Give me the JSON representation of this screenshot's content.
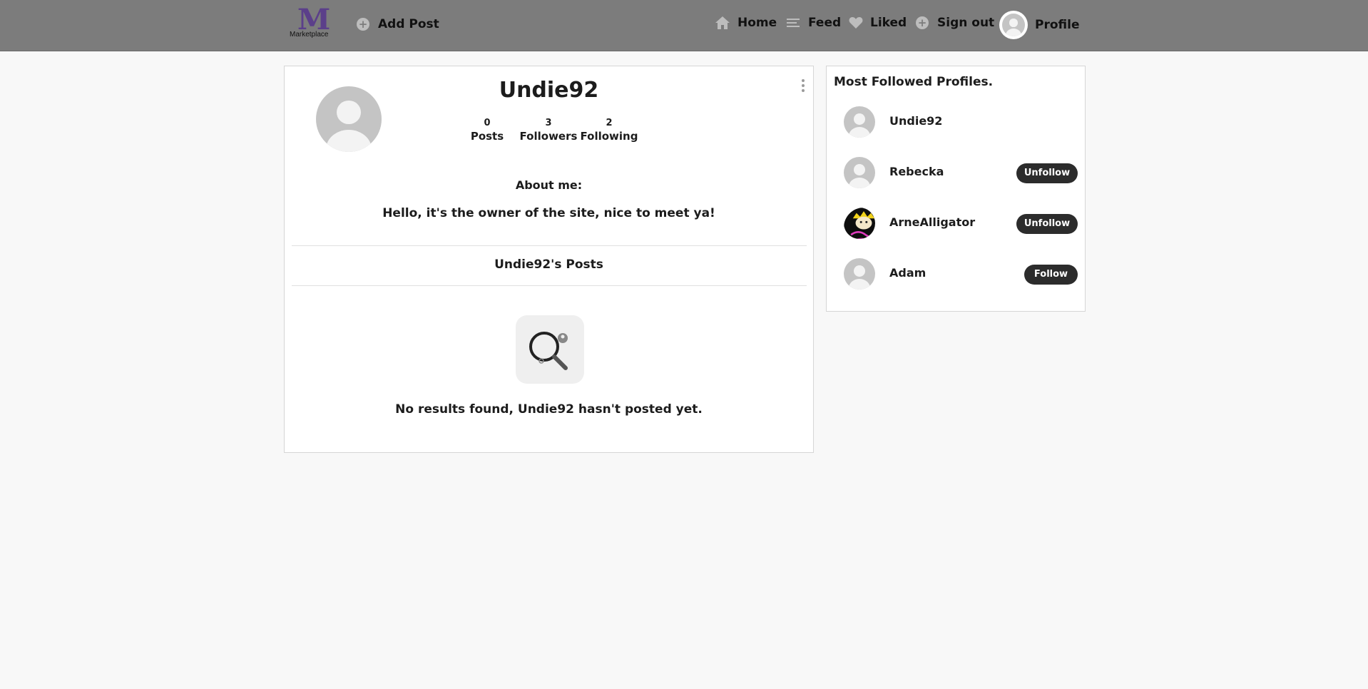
{
  "nav": {
    "logo_text": "Marketplace",
    "add_post": "Add Post",
    "home": "Home",
    "feed": "Feed",
    "liked": "Liked",
    "sign_out": "Sign out",
    "profile": "Profile",
    "colors": {
      "bar": "#7c7c7c",
      "logo": "#5b3f8a"
    }
  },
  "profile": {
    "name": "Undie92",
    "stats": [
      {
        "value": "0",
        "label": "Posts"
      },
      {
        "value": "3",
        "label": "Followers"
      },
      {
        "value": "2",
        "label": "Following"
      }
    ],
    "about_heading": "About me:",
    "about_text": "Hello, it's the owner of the site, nice to meet ya!",
    "posts_heading": "Undie92's Posts",
    "empty_message": "No results found, Undie92 hasn't posted yet."
  },
  "sidebar": {
    "title": "Most Followed Profiles.",
    "profiles": [
      {
        "name": "Undie92",
        "avatar": "default",
        "action": ""
      },
      {
        "name": "Rebecka",
        "avatar": "default",
        "action": "Unfollow"
      },
      {
        "name": "ArneAlligator",
        "avatar": "cartoon-photo",
        "action": "Unfollow"
      },
      {
        "name": "Adam",
        "avatar": "default",
        "action": "Follow"
      }
    ]
  }
}
